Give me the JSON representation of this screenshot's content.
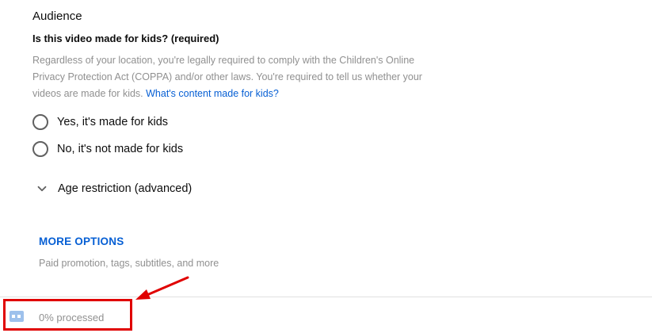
{
  "audience": {
    "title": "Audience",
    "question": "Is this video made for kids? (required)",
    "description": "Regardless of your location, you're legally required to comply with the Children's Online Privacy Protection Act (COPPA) and/or other laws. You're required to tell us whether your videos are made for kids. ",
    "link_text": "What's content made for kids?",
    "options": [
      {
        "label": "Yes, it's made for kids",
        "selected": false
      },
      {
        "label": "No, it's not made for kids",
        "selected": false
      }
    ]
  },
  "age_restriction": {
    "label": "Age restriction (advanced)",
    "icon": "chevron-down-icon"
  },
  "more_options": {
    "label": "MORE OPTIONS",
    "subtitle": "Paid promotion, tags, subtitles, and more"
  },
  "footer": {
    "status_text": "0% processed",
    "status_icon": "processing-icon",
    "progress_percent": 0
  },
  "colors": {
    "link": "#065fd4",
    "muted_text": "#909090",
    "annotation": "#e00000"
  }
}
